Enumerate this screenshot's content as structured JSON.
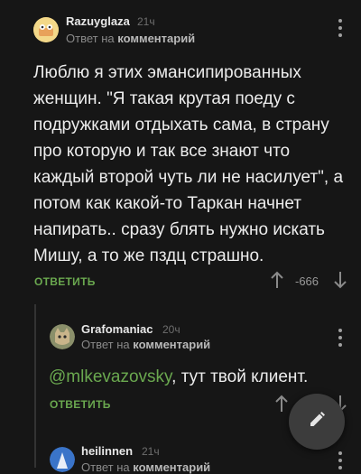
{
  "comments": [
    {
      "username": "Razuyglaza",
      "time": "21ч",
      "reply_prefix": "Ответ на",
      "reply_target": "комментарий",
      "text": "Люблю я этих эмансипированных женщин. \"Я такая крутая поеду с подружками отдыхать сама, в страну про которую и так все знают что каждый второй чуть ли не насилует\", а потом как какой-то Таркан начнет напирать.. сразу блять нужно искать Мишу, а то же пздц страшно.",
      "reply_label": "ОТВЕТИТЬ",
      "score": "-666"
    },
    {
      "username": "Grafomaniac",
      "time": "20ч",
      "reply_prefix": "Ответ на",
      "reply_target": "комментарий",
      "mention": "@mlkevazovsky",
      "text": ", тут твой клиент.",
      "reply_label": "ОТВЕТИТЬ"
    },
    {
      "username": "heilinnen",
      "time": "21ч",
      "reply_prefix": "Ответ на",
      "reply_target": "комментарий"
    }
  ],
  "icons": {
    "upvote": "arrow-up-icon",
    "downvote": "arrow-down-icon",
    "more": "more-vertical-icon",
    "edit": "pencil-icon"
  },
  "colors": {
    "background": "#161616",
    "accent_green": "#6aa84f",
    "fab": "#3c3c3c"
  }
}
